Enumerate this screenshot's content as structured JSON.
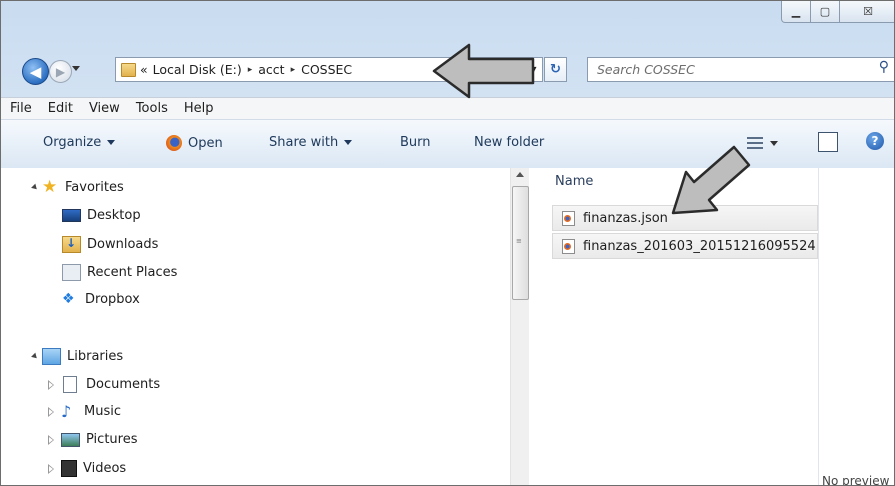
{
  "window": {
    "controls": {
      "minimize_icon": "minimize-icon",
      "maximize_icon": "maximize-icon",
      "close_icon": "close-icon",
      "close_glyph": "☒"
    }
  },
  "nav": {
    "back_glyph": "◀",
    "forward_glyph": "▶",
    "address": {
      "prefix": "«",
      "crumbs": [
        "Local Disk (E:)",
        "acct",
        "COSSEC"
      ],
      "separator": "▸"
    },
    "refresh_glyph": "↻",
    "search_placeholder": "Search COSSEC"
  },
  "menubar": {
    "items": [
      "File",
      "Edit",
      "View",
      "Tools",
      "Help"
    ]
  },
  "toolbar": {
    "organize": "Organize",
    "open": "Open",
    "share_with": "Share with",
    "burn": "Burn",
    "new_folder": "New folder",
    "help_glyph": "?"
  },
  "navpane": {
    "favorites": {
      "label": "Favorites",
      "items": [
        "Desktop",
        "Downloads",
        "Recent Places",
        "Dropbox"
      ]
    },
    "libraries": {
      "label": "Libraries",
      "items": [
        "Documents",
        "Music",
        "Pictures",
        "Videos"
      ]
    }
  },
  "filelist": {
    "column_name": "Name",
    "files": [
      {
        "name": "finanzas.json"
      },
      {
        "name": "finanzas_201603_20151216095524"
      }
    ],
    "preview_text": "No preview"
  },
  "colors": {
    "arrow_fill": "#bdbdbd",
    "arrow_stroke": "#2b2b2b"
  }
}
